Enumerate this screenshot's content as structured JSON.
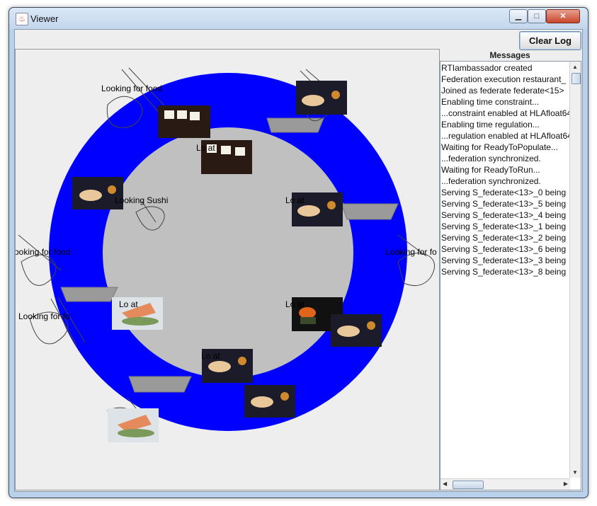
{
  "window": {
    "title": "Viewer",
    "minimize_glyph": "▁",
    "maximize_glyph": "□",
    "close_glyph": "✕",
    "java_icon": "♨"
  },
  "toolbar": {
    "clear_log_label": "Clear Log"
  },
  "messages": {
    "title": "Messages",
    "lines": [
      "RTIambassador created",
      "Federation execution restaurant_",
      "Joined as federate federate<15>",
      "Enabling time constraint...",
      "...constraint enabled at HLAfloat64",
      "Enabling time regulation...",
      "...regulation enabled at HLAfloat64",
      "Waiting for ReadyToPopulate...",
      "...federation synchronized.",
      "Waiting for ReadyToRun...",
      "...federation synchronized.",
      "Serving S_federate<13>_0 being",
      "Serving S_federate<13>_5 being",
      "Serving S_federate<13>_4 being",
      "Serving S_federate<13>_1 being",
      "Serving S_federate<13>_2 being",
      "Serving S_federate<13>_6 being",
      "Serving S_federate<13>_3 being",
      "Serving S_federate<13>_8 being"
    ]
  },
  "scene": {
    "labels": {
      "looking_food": "Looking for food",
      "looking_sushi": "Looking Sushi",
      "eat_partial": "Lo           at",
      "looking_food_trunc_left": "ooking for food",
      "looking_food_trunc_right": "Looking for fo",
      "looking_food_overlap": "Looking for fo"
    },
    "colors": {
      "belt": "#0000ff",
      "center": "#c0c0c0",
      "boat": "#9a9a9a"
    }
  }
}
